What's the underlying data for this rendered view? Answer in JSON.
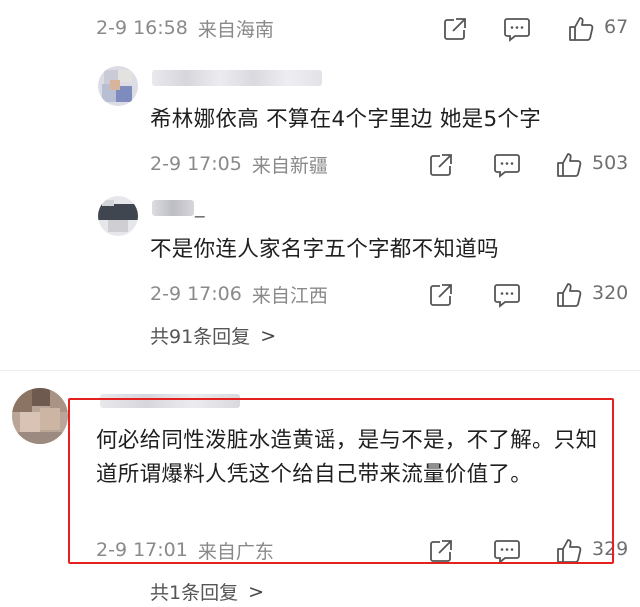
{
  "comment_top": {
    "date": "2-9 16:58",
    "location": "来自海南",
    "likes": "67"
  },
  "reply1": {
    "text": "希林娜依高 不算在4个字里边 她是5个字",
    "date": "2-9 17:05",
    "location": "来自新疆",
    "likes": "503"
  },
  "reply2": {
    "username_suffix": "_",
    "text": "不是你连人家名字五个字都不知道吗",
    "date": "2-9 17:06",
    "location": "来自江西",
    "likes": "320"
  },
  "thread1": {
    "reply_count": "共91条回复",
    "chevron": ">"
  },
  "comment2": {
    "text": "何必给同性泼脏水造黄谣，是与不是，不了解。只知道所谓爆料人凭这个给自己带来流量价值了。",
    "date": "2-9 17:01",
    "location": "来自广东",
    "likes": "329"
  },
  "thread2": {
    "reply_count": "共1条回复",
    "chevron": ">"
  },
  "colors": {
    "highlight_border": "#e3211f",
    "meta_text": "#8a8a8a",
    "body_text": "#1f1f1f"
  },
  "icons": [
    "share-icon",
    "comment-icon",
    "like-icon"
  ]
}
